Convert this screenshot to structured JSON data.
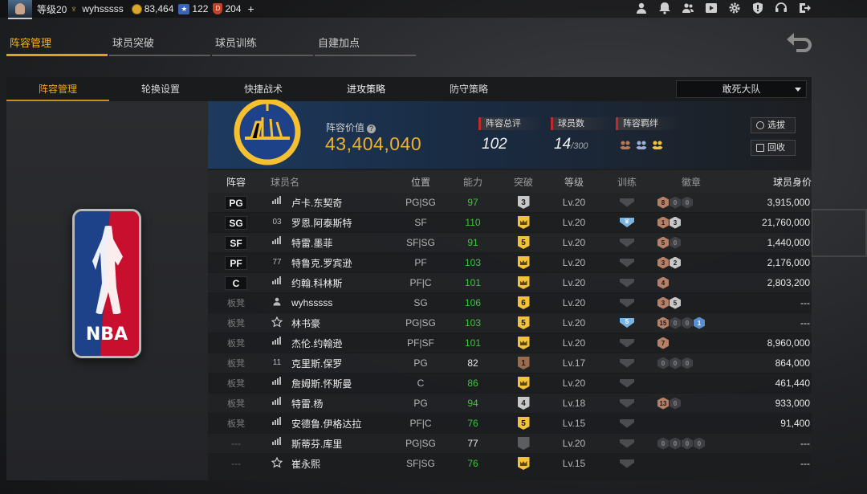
{
  "topbar": {
    "level": "等级20",
    "username": "wyhsssss",
    "coins": "83,464",
    "stars": "122",
    "tokens": "204",
    "plus": "+",
    "icons": [
      "user-icon",
      "bell-icon",
      "friends-icon",
      "video-icon",
      "gear-icon",
      "shield-icon",
      "headset-icon",
      "exit-icon"
    ]
  },
  "main_tabs": [
    "阵容管理",
    "球员突破",
    "球员训练",
    "自建加点"
  ],
  "sub_tabs": [
    "阵容管理",
    "轮换设置",
    "快捷战术",
    "进攻策略",
    "防守策略"
  ],
  "team_select": "敢死大队",
  "header": {
    "lineup_value_label": "阵容价值",
    "lineup_value": "43,404,040",
    "rating_label": "阵容总评",
    "rating": "102",
    "players_label": "球员数",
    "players_count": "14",
    "players_max": "/300",
    "bond_label": "阵容羁绊",
    "select_button": "选拔",
    "recycle_button": "回收"
  },
  "table": {
    "columns": [
      "阵容",
      "球员名",
      "位置",
      "能力",
      "突破",
      "等级",
      "训练",
      "徽章",
      "球员身价"
    ],
    "rows": [
      {
        "slot": "PG",
        "starter": true,
        "icon": "signal",
        "name": "卢卡.东契奇",
        "position": "PG|SG",
        "ability": "97",
        "ability_color": "green",
        "break": "3",
        "break_type": "silver",
        "level": "Lv.20",
        "train": "",
        "badges": [
          {
            "t": "bronze",
            "v": "8"
          },
          {
            "t": "dark",
            "v": "0"
          },
          {
            "t": "dark",
            "v": "0"
          }
        ],
        "value": "3,915,000"
      },
      {
        "slot": "SG",
        "starter": true,
        "icon": "03",
        "name": "罗恩.阿泰斯特",
        "position": "SF",
        "ability": "110",
        "ability_color": "green",
        "break": "crown",
        "break_type": "gold",
        "level": "Lv.20",
        "train": "blue",
        "badges": [
          {
            "t": "bronze",
            "v": "1"
          },
          {
            "t": "silver",
            "v": "3"
          }
        ],
        "value": "21,760,000"
      },
      {
        "slot": "SF",
        "starter": true,
        "icon": "signal",
        "name": "特雷.墨菲",
        "position": "SF|SG",
        "ability": "91",
        "ability_color": "green",
        "break": "5",
        "break_type": "gold",
        "level": "Lv.20",
        "train": "",
        "badges": [
          {
            "t": "bronze",
            "v": "5"
          },
          {
            "t": "dark",
            "v": "0"
          }
        ],
        "value": "1,440,000"
      },
      {
        "slot": "PF",
        "starter": true,
        "icon": "77",
        "name": "特鲁克.罗宾逊",
        "position": "PF",
        "ability": "103",
        "ability_color": "green",
        "break": "crown",
        "break_type": "gold",
        "level": "Lv.20",
        "train": "",
        "badges": [
          {
            "t": "bronze",
            "v": "3"
          },
          {
            "t": "silver",
            "v": "2"
          }
        ],
        "value": "2,176,000"
      },
      {
        "slot": "C",
        "starter": true,
        "icon": "signal",
        "name": "约翰.科林斯",
        "position": "PF|C",
        "ability": "101",
        "ability_color": "green",
        "break": "crown",
        "break_type": "gold",
        "level": "Lv.20",
        "train": "",
        "badges": [
          {
            "t": "bronze",
            "v": "4"
          }
        ],
        "value": "2,803,200"
      },
      {
        "slot": "板凳",
        "starter": false,
        "icon": "person",
        "name": "wyhsssss",
        "position": "SG",
        "ability": "106",
        "ability_color": "green",
        "break": "6",
        "break_type": "gold",
        "level": "Lv.20",
        "train": "",
        "badges": [
          {
            "t": "bronze",
            "v": "3"
          },
          {
            "t": "silver",
            "v": "5"
          }
        ],
        "value": "---"
      },
      {
        "slot": "板凳",
        "starter": false,
        "icon": "star",
        "name": "林书豪",
        "position": "PG|SG",
        "ability": "103",
        "ability_color": "green",
        "break": "5",
        "break_type": "gold",
        "level": "Lv.20",
        "train": "blue5",
        "badges": [
          {
            "t": "bronze",
            "v": "15"
          },
          {
            "t": "dark",
            "v": "0"
          },
          {
            "t": "dark",
            "v": "0"
          },
          {
            "t": "blue",
            "v": "1"
          }
        ],
        "value": "---"
      },
      {
        "slot": "板凳",
        "starter": false,
        "icon": "signal",
        "name": "杰伦.约翰逊",
        "position": "PF|SF",
        "ability": "101",
        "ability_color": "green",
        "break": "crown",
        "break_type": "gold",
        "level": "Lv.20",
        "train": "",
        "badges": [
          {
            "t": "bronze",
            "v": "7"
          }
        ],
        "value": "8,960,000"
      },
      {
        "slot": "板凳",
        "starter": false,
        "icon": "11",
        "name": "克里斯.保罗",
        "position": "PG",
        "ability": "82",
        "ability_color": "white",
        "break": "1",
        "break_type": "bronze",
        "level": "Lv.17",
        "train": "",
        "badges": [
          {
            "t": "dark",
            "v": "0"
          },
          {
            "t": "dark",
            "v": "0"
          },
          {
            "t": "dark",
            "v": "0"
          }
        ],
        "value": "864,000"
      },
      {
        "slot": "板凳",
        "starter": false,
        "icon": "signal",
        "name": "詹姆斯.怀斯曼",
        "position": "C",
        "ability": "86",
        "ability_color": "green",
        "break": "crown",
        "break_type": "gold",
        "level": "Lv.20",
        "train": "",
        "badges": [],
        "value": "461,440"
      },
      {
        "slot": "板凳",
        "starter": false,
        "icon": "signal",
        "name": "特雷.杨",
        "position": "PG",
        "ability": "94",
        "ability_color": "green",
        "break": "4",
        "break_type": "silver",
        "level": "Lv.18",
        "train": "",
        "badges": [
          {
            "t": "bronze",
            "v": "13"
          },
          {
            "t": "dark",
            "v": "0"
          }
        ],
        "value": "933,000"
      },
      {
        "slot": "板凳",
        "starter": false,
        "icon": "signal",
        "name": "安德鲁.伊格达拉",
        "position": "PF|C",
        "ability": "76",
        "ability_color": "green",
        "break": "5",
        "break_type": "gold",
        "level": "Lv.15",
        "train": "",
        "badges": [],
        "value": "91,400"
      },
      {
        "slot": "---",
        "starter": false,
        "icon": "signal",
        "name": "斯蒂芬.库里",
        "position": "PG|SG",
        "ability": "77",
        "ability_color": "white",
        "break": "",
        "break_type": "dark",
        "level": "Lv.20",
        "train": "",
        "badges": [
          {
            "t": "dark",
            "v": "0"
          },
          {
            "t": "dark",
            "v": "0"
          },
          {
            "t": "dark",
            "v": "0"
          },
          {
            "t": "dark",
            "v": "0"
          }
        ],
        "value": "---"
      },
      {
        "slot": "---",
        "starter": false,
        "icon": "star",
        "name": "崔永熙",
        "position": "SF|SG",
        "ability": "76",
        "ability_color": "green",
        "break": "crown",
        "break_type": "gold",
        "level": "Lv.15",
        "train": "",
        "badges": [],
        "value": "---"
      }
    ]
  },
  "colors": {
    "accent": "#f0b12a",
    "green": "#3ec63e",
    "panel": "#1c1d1f"
  }
}
